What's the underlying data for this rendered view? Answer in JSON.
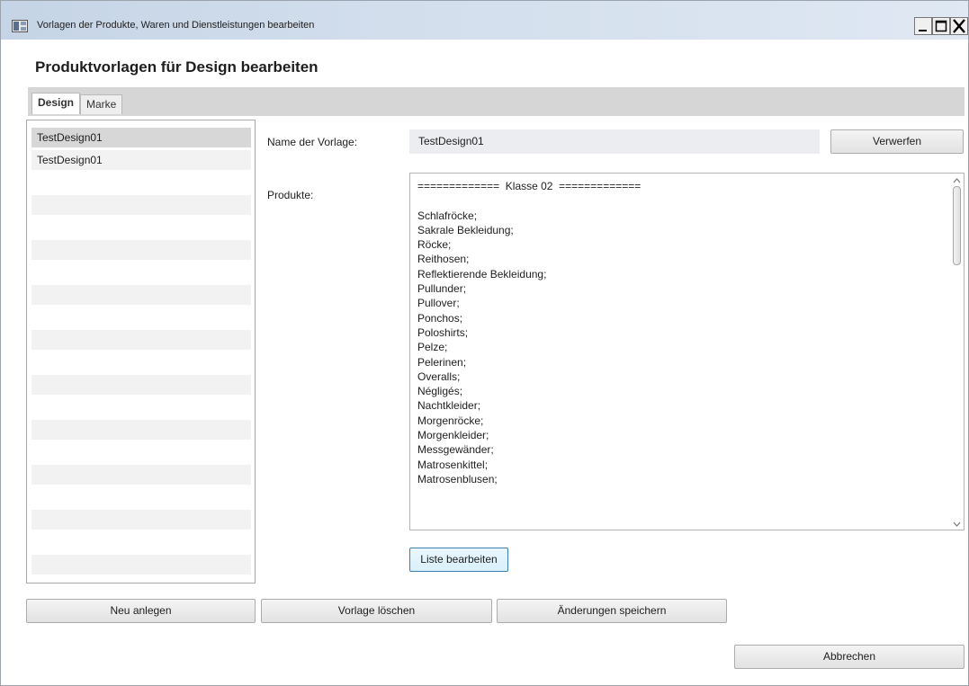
{
  "window": {
    "title": "Vorlagen der Produkte, Waren und Dienstleistungen bearbeiten",
    "icon": "window-app-icon"
  },
  "header": {
    "title": "Produktvorlagen für Design bearbeiten"
  },
  "tabs": [
    {
      "label": "Design",
      "active": true
    },
    {
      "label": "Marke",
      "active": false
    }
  ],
  "template_list": {
    "items": [
      "TestDesign01",
      "TestDesign01"
    ]
  },
  "form": {
    "name_label": "Name der Vorlage:",
    "name_value": "TestDesign01",
    "discard_button": "Verwerfen",
    "products_label": "Produkte:",
    "products_text": "=============  Klasse 02  =============\n\nSchlafröcke;\nSakrale Bekleidung;\nRöcke;\nReithosen;\nReflektierende Bekleidung;\nPullunder;\nPullover;\nPonchos;\nPoloshirts;\nPelze;\nPelerinen;\nOveralls;\nNégligés;\nNachtkleider;\nMorgenröcke;\nMorgenkleider;\nMessgewänder;\nMatrosenkittel;\nMatrosenblusen;",
    "edit_list_button": "Liste bearbeiten"
  },
  "footer": {
    "new_button": "Neu anlegen",
    "delete_button": "Vorlage löschen",
    "save_button": "Änderungen speichern",
    "cancel_button": "Abbrechen"
  }
}
